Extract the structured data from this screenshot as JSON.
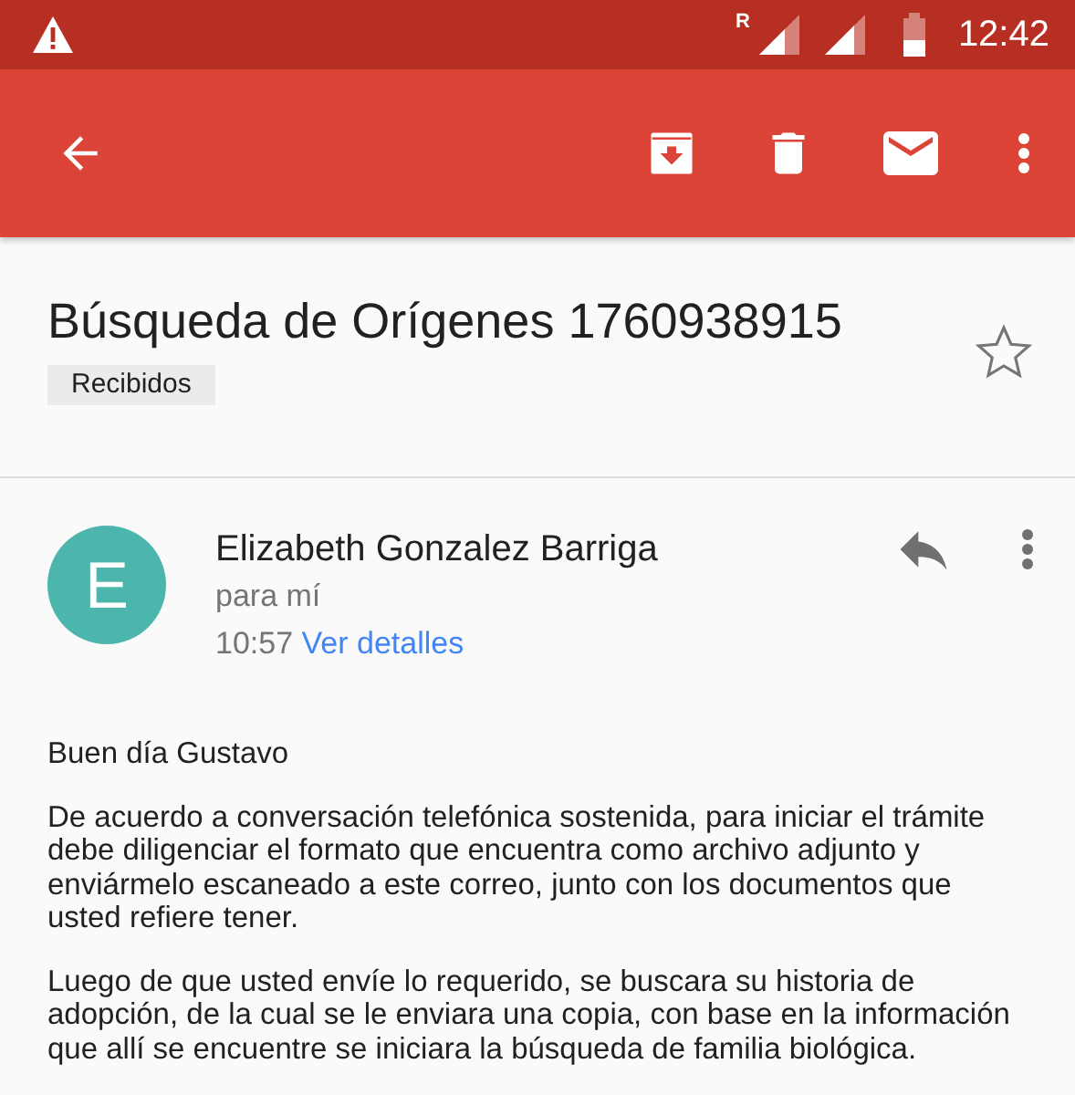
{
  "status_bar": {
    "time": "12:42",
    "roaming_label": "R"
  },
  "toolbar": {
    "actions": [
      {
        "kind": "back"
      },
      {
        "kind": "archive"
      },
      {
        "kind": "delete"
      },
      {
        "kind": "mark-unread"
      },
      {
        "kind": "more"
      }
    ]
  },
  "subject": "Búsqueda de Orígenes 1760938915",
  "label": "Recibidos",
  "starred": false,
  "message": {
    "avatar_letter": "E",
    "sender": "Elizabeth Gonzalez Barriga",
    "recipient": "para mí",
    "time": "10:57",
    "details_link": "Ver detalles",
    "body": [
      "Buen día Gustavo",
      "De acuerdo a conversación telefónica sostenida, para iniciar el trámite debe diligenciar el formato que encuentra como archivo adjunto y enviármelo escaneado a este correo, junto con los documentos que usted refiere tener.",
      "Luego de que usted envíe lo requerido, se buscara su historia de adopción, de la cual se le enviara una copia, con base en la información que allí se encuentre se iniciara la búsqueda de familia biológica."
    ]
  }
}
